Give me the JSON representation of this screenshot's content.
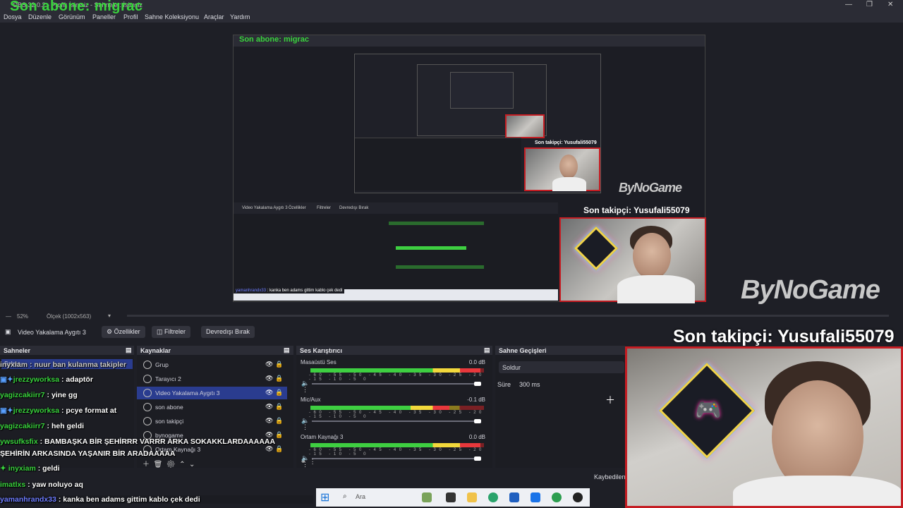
{
  "window": {
    "title": "OBS 32.0.2 - Profil: İsimsiz - Sahneler: İsimsiz",
    "overlay_abone": "Son abone: migrac"
  },
  "menu": [
    "Dosya",
    "Düzenle",
    "Görünüm",
    "Paneller",
    "Profil",
    "Sahne Koleksiyonu",
    "Araçlar",
    "Yardım"
  ],
  "preview": {
    "bynogame": "ByNoGame",
    "takipci": "Son takipçi: Yusufali55079",
    "nested_abone": "Son abone: migrac"
  },
  "status": {
    "zoom": "52%",
    "scale": "Ölçek (1002x563)"
  },
  "toolbar": {
    "source_name": "Video Yakalama Aygıtı 3",
    "properties": "Özellikler",
    "filters": "Filtreler",
    "deactivate": "Devredışı Bırak"
  },
  "panels": {
    "scenes": "Sahneler",
    "sources": "Kaynaklar",
    "mixer": "Ses Karıştırıcı",
    "transitions": "Sahne Geçişleri"
  },
  "scenes_partial": "Sahne",
  "sources": [
    {
      "name": "Grup",
      "selected": false
    },
    {
      "name": "Tarayıcı 2",
      "selected": false
    },
    {
      "name": "Video Yakalama Aygıtı 3",
      "selected": true
    },
    {
      "name": "son abone",
      "selected": false
    },
    {
      "name": "son takipçi",
      "selected": false
    },
    {
      "name": "bynogame",
      "selected": false
    },
    {
      "name": "Ortam Kaynağı 3",
      "selected": false
    }
  ],
  "mixer": [
    {
      "name": "Masaüstü Ses",
      "db": "0.0 dB",
      "level": 0.98,
      "volume": 1.0
    },
    {
      "name": "Mic/Aux",
      "db": "-0.1 dB",
      "level": 0.8,
      "volume": 1.0
    },
    {
      "name": "Ortam Kaynağı 3",
      "db": "0.0 dB",
      "level": 0.98,
      "volume": 1.0
    }
  ],
  "scale_text": "-60 -55 -50 -45 -40 -35 -30 -25 -20 -15 -10 -5 0",
  "transitions": {
    "type": "Soldur",
    "duration_label": "Süre",
    "duration": "300 ms"
  },
  "recording": "Kaybedilen",
  "overlay_takipci": "Son takipçi: Yusufali55079",
  "chat": [
    {
      "user": "",
      "msg": "inyxiam : nuur ban kulanma takipler"
    },
    {
      "user": "jrezzyworksa",
      "msg": " : adaptör"
    },
    {
      "user": "yagizcakiirr7",
      "msg": " : yine gg"
    },
    {
      "user": "jrezzyworksa",
      "msg": " : pcye format at"
    },
    {
      "user": "yagizcakiirr7",
      "msg": " : heh geldi"
    },
    {
      "user": "ywsufksfix",
      "msg": " : BAMBAŞKA BİR ŞEHİRRR VARRR ARKA SOKAKKLARDAAAAAA"
    },
    {
      "user": "",
      "msg": "ŞEHİRİN ARKASINDA YAŞANIR BİR ARADAAAAA"
    },
    {
      "user": "inyxiam",
      "msg": " : geldi"
    },
    {
      "user": "imatlxs",
      "msg": " : yaw noluyo aq"
    },
    {
      "user": "yamanhrandx33",
      "msg": " : kanka ben adams gittim kablo çek dedi"
    }
  ],
  "taskbar": {
    "search": "Ara"
  }
}
